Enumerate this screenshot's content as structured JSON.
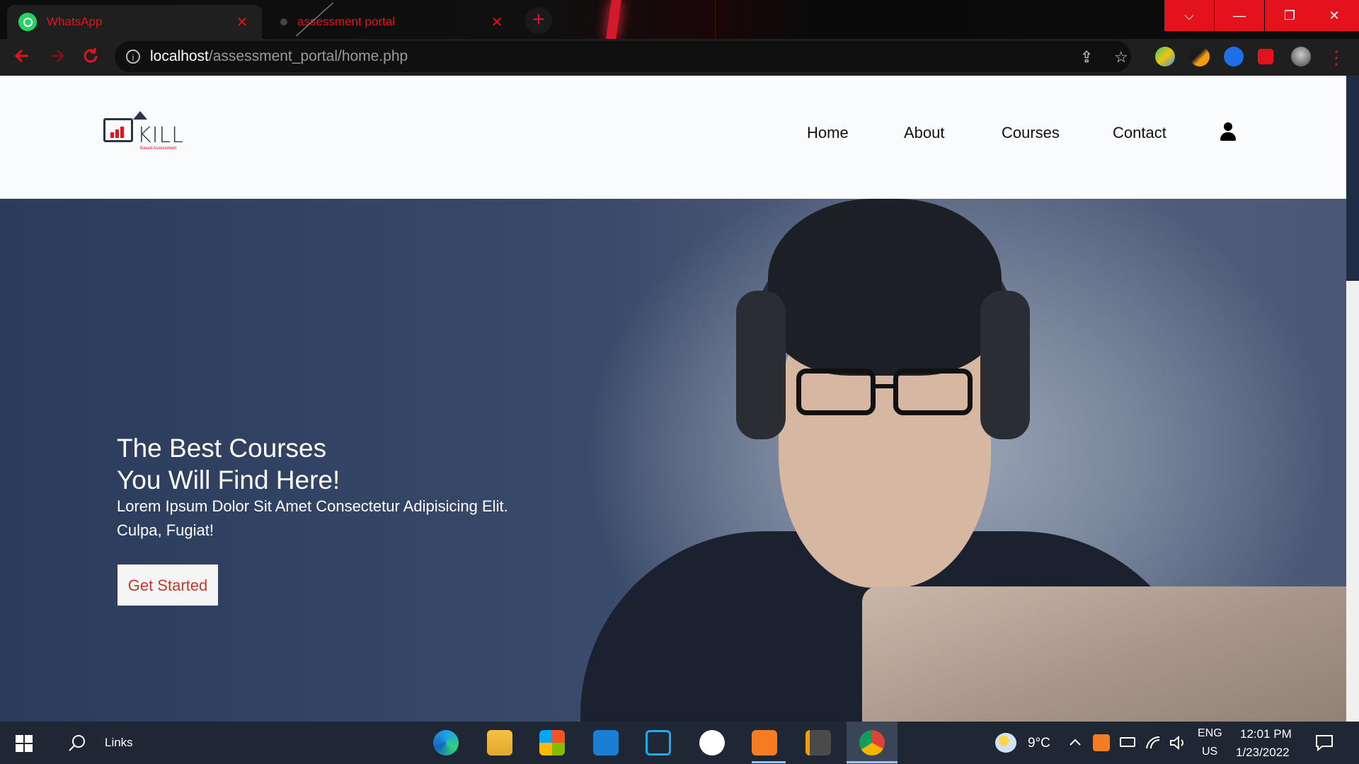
{
  "browser": {
    "tabs": [
      {
        "title": "WhatsApp",
        "close": "✕"
      },
      {
        "title": "assessment portal",
        "close": "✕"
      }
    ],
    "new_tab": "+",
    "window_controls": {
      "dropdown": "⌵",
      "minimize": "—",
      "restore": "❐",
      "close": "✕"
    },
    "url": {
      "host": "localhost",
      "path": "/assessment_portal/home.php"
    },
    "icons": {
      "back": "arrow-left-icon",
      "forward": "arrow-right-icon",
      "reload": "reload-icon",
      "share": "⇪",
      "star": "☆",
      "menu": "⋮"
    },
    "accent": "#e3121d"
  },
  "site": {
    "logo": {
      "word": "KILL",
      "tagline": "Based Assessment"
    },
    "nav": [
      "Home",
      "About",
      "Courses",
      "Contact"
    ],
    "hero": {
      "title_line1": "The Best Courses",
      "title_line2": "You Will Find Here!",
      "subtitle_line1": "Lorem Ipsum Dolor Sit Amet Consectetur Adipisicing Elit.",
      "subtitle_line2": "Culpa, Fugiat!",
      "cta": "Get Started"
    }
  },
  "taskbar": {
    "search_label": "Links",
    "weather": "9°C",
    "lang_line1": "ENG",
    "lang_line2": "US",
    "time": "12:01 PM",
    "date": "1/23/2022"
  }
}
